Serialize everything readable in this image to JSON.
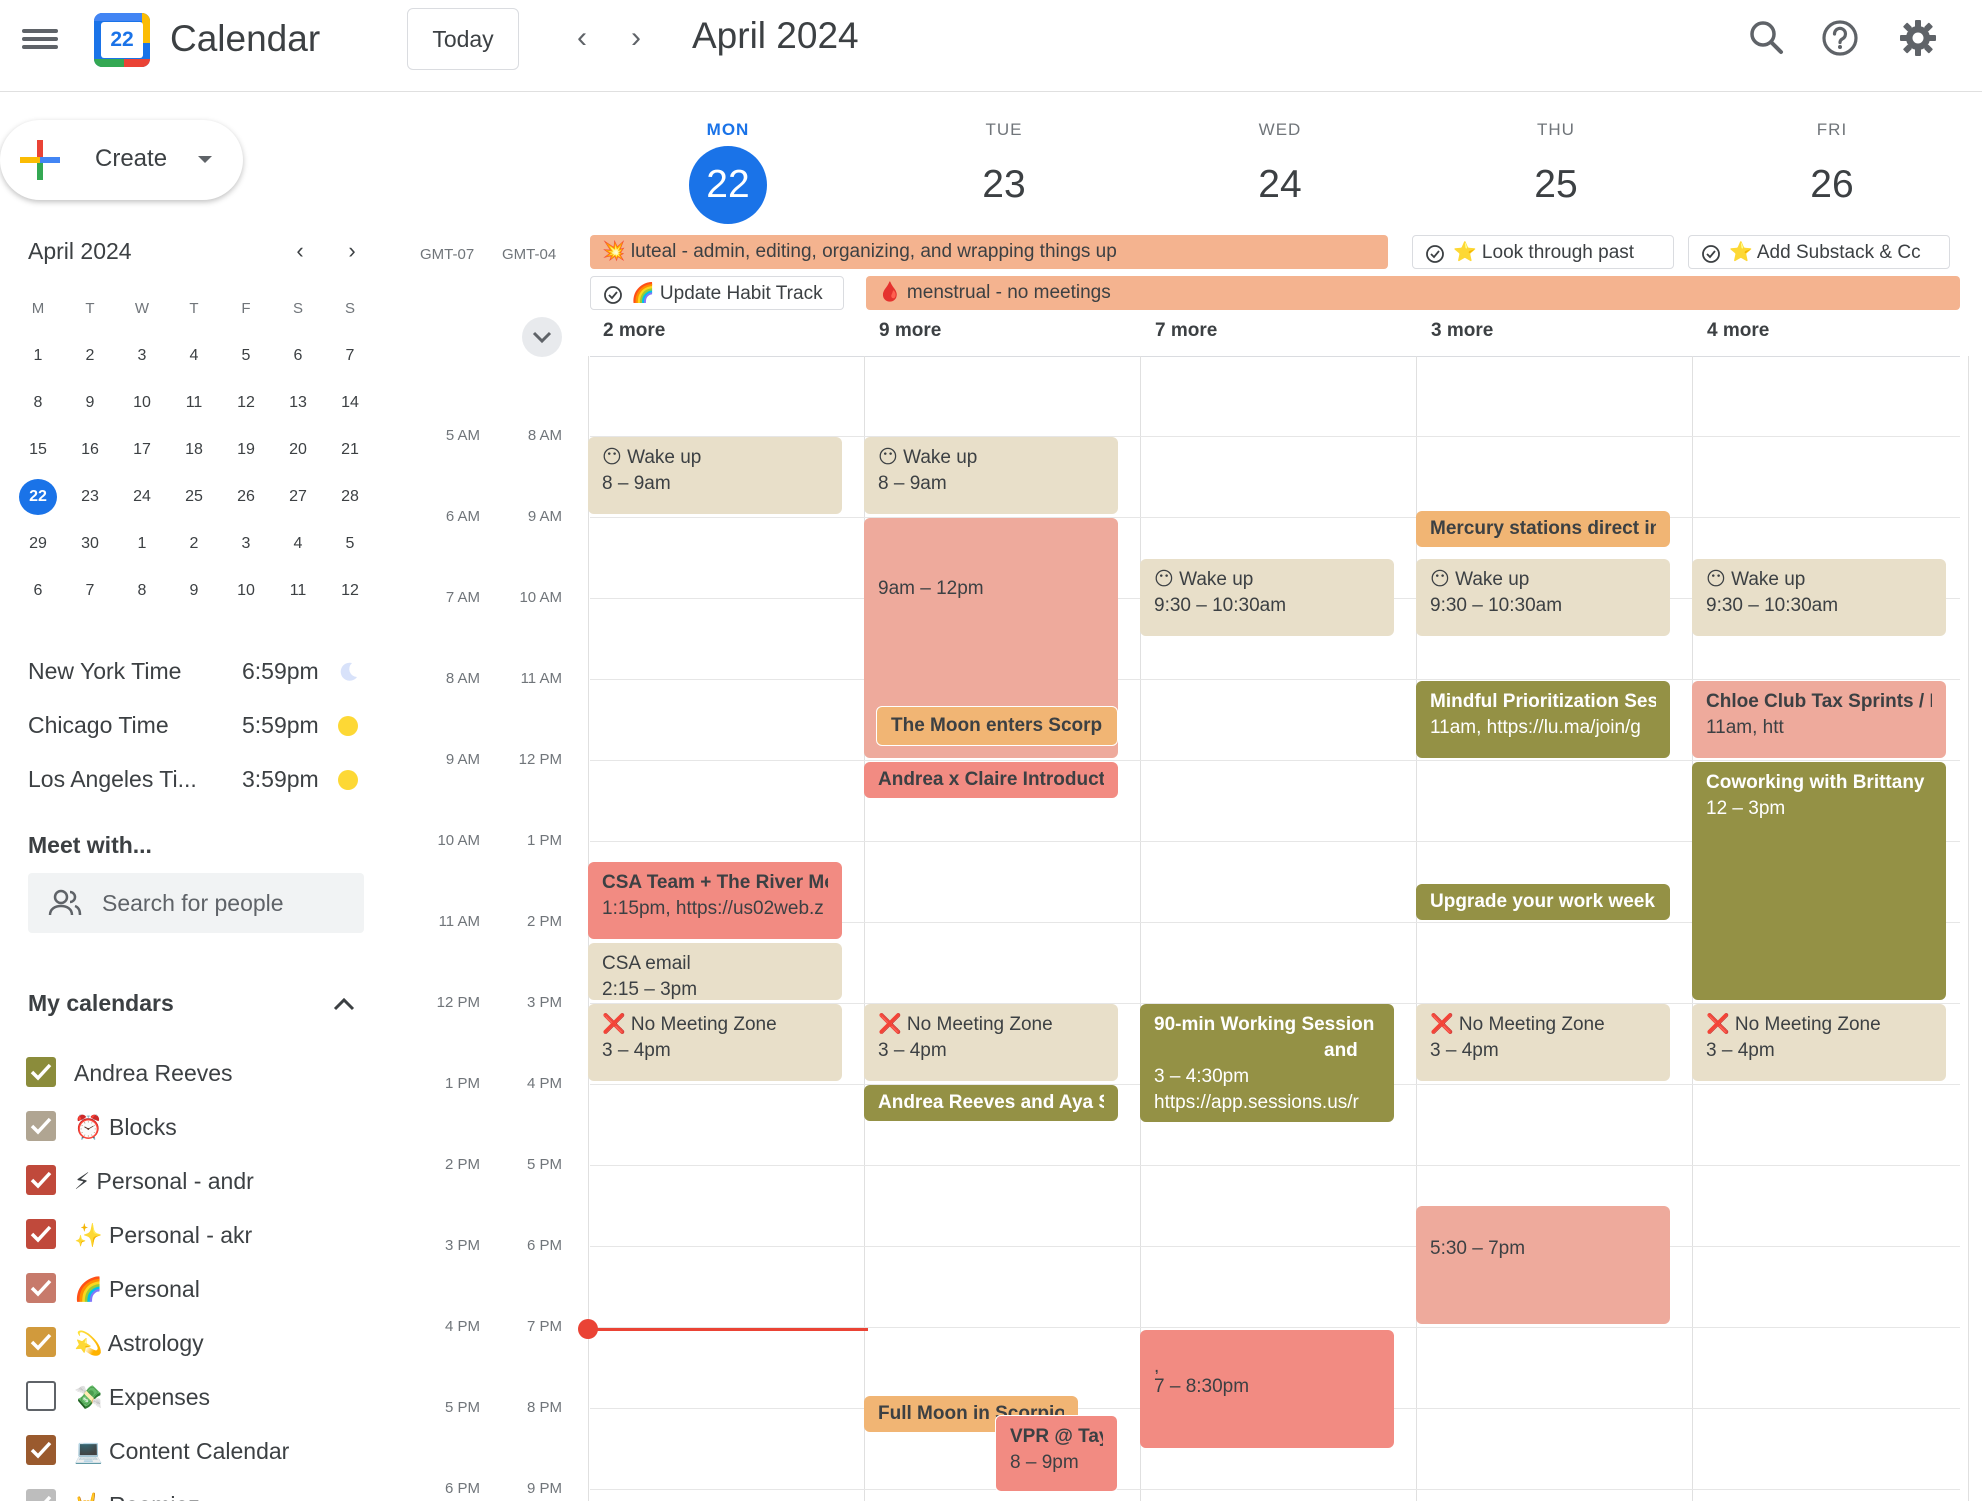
{
  "app": {
    "title": "Calendar",
    "logo_day": "22"
  },
  "toolbar": {
    "today": "Today",
    "month": "April 2024"
  },
  "sidebar": {
    "create_label": "Create",
    "mini_calendar": {
      "title": "April 2024",
      "weekdays": [
        "M",
        "T",
        "W",
        "T",
        "F",
        "S",
        "S"
      ],
      "weeks": [
        [
          "1",
          "2",
          "3",
          "4",
          "5",
          "6",
          "7"
        ],
        [
          "8",
          "9",
          "10",
          "11",
          "12",
          "13",
          "14"
        ],
        [
          "15",
          "16",
          "17",
          "18",
          "19",
          "20",
          "21"
        ],
        [
          "22",
          "23",
          "24",
          "25",
          "26",
          "27",
          "28"
        ],
        [
          "29",
          "30",
          "1",
          "2",
          "3",
          "4",
          "5"
        ],
        [
          "6",
          "7",
          "8",
          "9",
          "10",
          "11",
          "12"
        ]
      ],
      "selected": "22"
    },
    "timezones": [
      {
        "name": "New York Time",
        "time": "6:59pm",
        "icon": "moon-icon"
      },
      {
        "name": "Chicago Time",
        "time": "5:59pm",
        "icon": "sun-icon"
      },
      {
        "name": "Los Angeles Ti...",
        "time": "3:59pm",
        "icon": "sun-icon"
      }
    ],
    "meet_with": "Meet with...",
    "search_placeholder": "Search for people",
    "my_calendars": "My calendars",
    "calendars": [
      {
        "label": "Andrea Reeves",
        "color": "#8b8c3b",
        "checked": true
      },
      {
        "label": "⏰ Blocks",
        "color": "#b0a592",
        "checked": true
      },
      {
        "label": "⚡ Personal - andr",
        "color": "#c0493b",
        "checked": true
      },
      {
        "label": "✨ Personal - akr",
        "color": "#c0493b",
        "checked": true
      },
      {
        "label": "🌈 Personal",
        "color": "#c77a6b",
        "checked": true
      },
      {
        "label": "💫 Astrology",
        "color": "#d19a3c",
        "checked": true
      },
      {
        "label": "💸 Expenses",
        "color": "#ffffff",
        "checked": false
      },
      {
        "label": "💻 Content Calendar",
        "color": "#9a5a2e",
        "checked": true
      },
      {
        "label": "🤟 Roomiez",
        "color": "#bdbdbd",
        "checked": true
      }
    ]
  },
  "week": {
    "days": [
      {
        "dow": "MON",
        "num": "22",
        "today": true
      },
      {
        "dow": "TUE",
        "num": "23",
        "today": false
      },
      {
        "dow": "WED",
        "num": "24",
        "today": false
      },
      {
        "dow": "THU",
        "num": "25",
        "today": false
      },
      {
        "dow": "FRI",
        "num": "26",
        "today": false
      }
    ],
    "gmt_left": "GMT-07",
    "gmt_right": "GMT-04",
    "allday": [
      {
        "text": "💥 luteal - admin, editing, organizing, and wrapping things up"
      },
      {
        "text": "⭐ Look through past"
      },
      {
        "text": "⭐ Add Substack & Cc"
      },
      {
        "text": "🌈 Update Habit Track"
      },
      {
        "text": "🩸 menstrual - no meetings"
      }
    ],
    "more": [
      "2 more",
      "9 more",
      "7 more",
      "3 more",
      "4 more"
    ],
    "hours_left": [
      "5 AM",
      "6 AM",
      "7 AM",
      "8 AM",
      "9 AM",
      "10 AM",
      "11 AM",
      "12 PM",
      "1 PM",
      "2 PM",
      "3 PM",
      "4 PM",
      "5 PM",
      "6 PM"
    ],
    "hours_right": [
      "8 AM",
      "9 AM",
      "10 AM",
      "11 AM",
      "12 PM",
      "1 PM",
      "2 PM",
      "3 PM",
      "4 PM",
      "5 PM",
      "6 PM",
      "7 PM",
      "8 PM",
      "9 PM"
    ]
  },
  "events": {
    "mon_wake": {
      "title": "😶 Wake up",
      "time": "8 – 9am"
    },
    "mon_csa": {
      "title": "CSA Team + The River Mee",
      "time": "1:15pm, https://us02web.z"
    },
    "mon_csa_email": {
      "title": "CSA email",
      "time": "2:15 – 3pm"
    },
    "mon_nmz": {
      "title": "❌ No Meeting Zone",
      "time": "3 – 4pm"
    },
    "tue_wake": {
      "title": "😶 Wake up",
      "time": "8 – 9am"
    },
    "tue_block": {
      "title": "9am – 12pm"
    },
    "tue_moon": {
      "title": "The Moon enters Scorpio"
    },
    "tue_andrea": {
      "title": "Andrea x Claire Introductio"
    },
    "tue_nmz": {
      "title": "❌ No Meeting Zone",
      "time": "3 – 4pm"
    },
    "tue_aya": {
      "title": "Andrea Reeves and Aya Su"
    },
    "tue_fullmoon": {
      "title": "Full Moon in Scorpio"
    },
    "tue_vpr": {
      "title": "VPR @ TayFl",
      "time": "8 – 9pm"
    },
    "wed_wake": {
      "title": "😶 Wake up",
      "time": "9:30 – 10:30am"
    },
    "wed_90": {
      "title": "90-min Working Session -",
      "line2": "and",
      "time": "3 – 4:30pm",
      "url": "https://app.sessions.us/r"
    },
    "wed_evening": {
      "title": ",",
      "time": "7 – 8:30pm"
    },
    "thu_mercury": {
      "title": "Mercury stations direct in"
    },
    "thu_wake": {
      "title": "😶 Wake up",
      "time": "9:30 – 10:30am"
    },
    "thu_mindful": {
      "title": "Mindful Prioritization Sess",
      "time": "11am, https://lu.ma/join/g"
    },
    "thu_upgrade": {
      "title": "Upgrade your work week b"
    },
    "thu_nmz": {
      "title": "❌ No Meeting Zone",
      "time": "3 – 4pm"
    },
    "thu_evening": {
      "title": "5:30 – 7pm"
    },
    "fri_wake": {
      "title": "😶 Wake up",
      "time": "9:30 – 10:30am"
    },
    "fri_chloe": {
      "title": "Chloe Club Tax Sprints / M",
      "time": "11am, htt"
    },
    "fri_cowork": {
      "title": "Coworking with Brittany",
      "time": "12 – 3pm"
    },
    "fri_nmz": {
      "title": "❌ No Meeting Zone",
      "time": "3 – 4pm"
    }
  }
}
